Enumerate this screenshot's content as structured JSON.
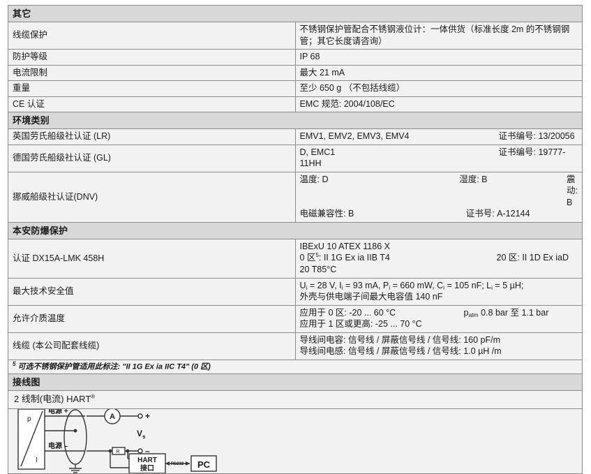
{
  "sections": [
    {
      "id": "misc",
      "title": "其它",
      "rows": [
        {
          "label": "线缆保护",
          "value": "不锈钢保护管配合不锈钢液位计：一体供货（标准长度 2m 的不锈钢钢管；其它长度请咨询）"
        },
        {
          "label": "防护等级",
          "value": "IP 68"
        },
        {
          "label": "电流限制",
          "value": "最大 21 mA"
        },
        {
          "label": "重量",
          "value": "至少  650 g  （不包括线缆）"
        },
        {
          "label": "CE 认证",
          "value": "EMC  规范: 2004/108/EC"
        }
      ]
    },
    {
      "id": "environment",
      "title": "环境类别",
      "rows": [
        {
          "label": "英国劳氏船级社认证 (LR)",
          "value": "EMV1, EMV2, EMV3, EMV4",
          "cert": "证书编号: 13/20056"
        },
        {
          "label": "德国劳氏船级社认证 (GL)",
          "value": "D, EMC1",
          "cert": "证书编号: 19777-11HH"
        }
      ],
      "dnv": {
        "label": "挪威船级社认证(DNV)",
        "line1_col1": "温度: D",
        "line1_col2": "湿度: B",
        "line1_col3": "震动: B",
        "line2_col1": "电磁兼容性: B",
        "line2_col2": "证书号: A-12144"
      }
    },
    {
      "id": "exprotection",
      "title": "本安防爆保护",
      "approval": {
        "label": "认证 DX15A-LMK 458H",
        "line1": "IBExU 10 ATEX 1186 X",
        "zone0_prefix": "0 区",
        "zone0_footnote": "5",
        "zone0_text": ": II 1G Ex ia IIB T4",
        "zone20": "20 区: II 1D Ex iaD 20 T85°C"
      },
      "safety": {
        "label": "最大技术安全值",
        "line1_parts": "Ui = 28 V, Ii = 93 mA, Pi = 660 mW, Ci = 105 nF; Li = 5 µH;",
        "line2": "外壳与供电端子间最大电容值 140 nF"
      },
      "temperature": {
        "label": "允许介质温度",
        "line1a": "应用于 0 区:  -20 ... 60 °C",
        "line1b_sub": "patm 0.8 bar 至 1.1 bar",
        "line2": "应用于 1 区或更高:  -25 ... 70 °C"
      },
      "cable": {
        "label": "线缆 (本公司配套线缆)",
        "line1": "导线间电容: 信号线 / 屏蔽信号线 / 信号线: 160 pF/m",
        "line2": "导线间电感: 信号线 / 屏蔽信号线 / 信号线: 1.0 µH /m"
      },
      "footnote": {
        "marker": "5",
        "text": " 可选不锈钢保护管适用此标注: \"II 1G Ex ia IIC T4\"   (0 区)"
      }
    }
  ],
  "wiring": {
    "title": "接线图",
    "subtitle_pre": "2 线制(电流) HART",
    "subtitle_sup": "®",
    "labels": {
      "sensor_p": "p",
      "sensor_i": "I",
      "power_plus": "电源 +",
      "power_minus": "电源 –",
      "ammeter": "A",
      "resistor": "R",
      "terminal_plus": "+",
      "terminal_minus": "–",
      "supply_v": "V",
      "supply_v_sub": "s",
      "hart_line1": "HART",
      "hart_line2": "接口",
      "rs232": "RS232",
      "pc": "PC"
    }
  }
}
